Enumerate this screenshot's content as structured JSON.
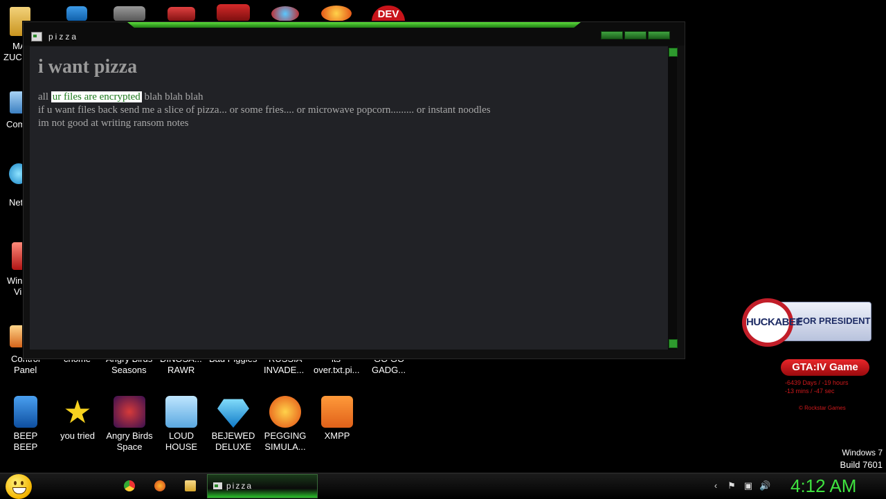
{
  "desktop": {
    "partial_left_labels": [
      "MA",
      "ZUCK",
      "Com",
      "Net",
      "Win",
      "Vi"
    ],
    "row_labels_partial": [
      "Control",
      "Panel",
      "chome",
      "Angry Birds",
      "Seasons",
      "DINOSA...",
      "RAWR",
      "Bad Piggies",
      "RUSSIA",
      "INVADE...",
      "its",
      "over.txt.pi...",
      "GO GO",
      "GADG..."
    ],
    "bottom_icons": [
      {
        "l1": "BEEP",
        "l2": "BEEP",
        "color": "#1e6fd0"
      },
      {
        "l1": "you tried",
        "l2": "",
        "color": "#f7d21f"
      },
      {
        "l1": "Angry Birds",
        "l2": "Space",
        "color": "#7b2a8a"
      },
      {
        "l1": "LOUD",
        "l2": "HOUSE",
        "color": "#7ac8f0"
      },
      {
        "l1": "BEJEWED",
        "l2": "DELUXE",
        "color": "#2aa7e8"
      },
      {
        "l1": "PEGGING",
        "l2": "SIMULA...",
        "color": "#f05a1e"
      },
      {
        "l1": "XMPP",
        "l2": "",
        "color": "#f07a1e"
      }
    ],
    "top_icon_badge": "DEV"
  },
  "window": {
    "title": "pizza",
    "heading": "i want pizza",
    "line1_pre": "all ",
    "line1_highlight": "ur files are encrypted",
    "line1_post": " blah blah blah",
    "line2": "if u want files back send me a slice of pizza... or some fries.... or microwave popcorn......... or instant noodles",
    "line3": "im not good at writing ransom notes"
  },
  "widgets": {
    "huckabee_name": "HUCKABEE",
    "huckabee_tag": "FOR PRESIDENT",
    "gta_title": "GTA:IV Game",
    "gta_line1": "-6439 Days / -19 hours",
    "gta_line2": "-13 mins / -47 sec",
    "gta_footer": "© Rockstar Games"
  },
  "os": {
    "version": "Windows 7",
    "build": "Build 7601"
  },
  "taskbar": {
    "task_title": "pizza",
    "clock": "4:12 AM"
  }
}
